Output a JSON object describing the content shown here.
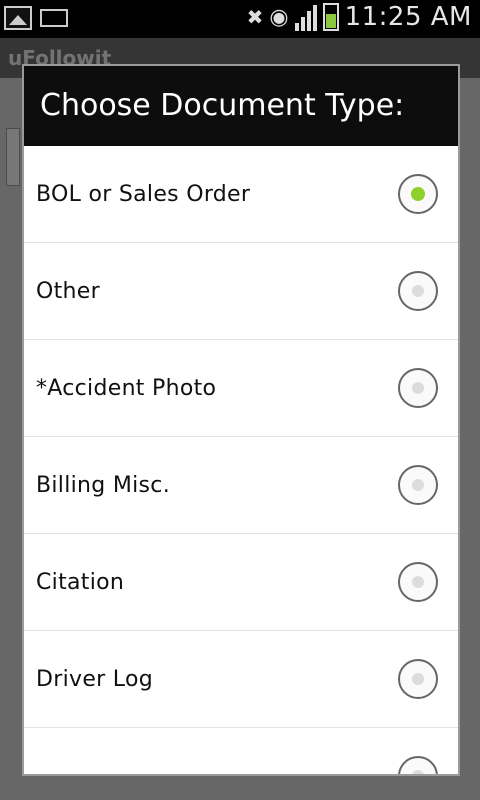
{
  "statusbar": {
    "time": "11:25 AM",
    "left_icons": [
      "image-icon",
      "mail-sync-icon"
    ],
    "right_icons": [
      "mute-icon",
      "wifi-icon",
      "signal-icon",
      "battery-icon"
    ],
    "battery_color": "#8bc63f"
  },
  "app": {
    "title": "uFollowit"
  },
  "dialog": {
    "title": "Choose Document Type:",
    "options": [
      {
        "label": "BOL or Sales Order",
        "selected": true
      },
      {
        "label": "Other",
        "selected": false
      },
      {
        "label": "*Accident Photo",
        "selected": false
      },
      {
        "label": "Billing Misc.",
        "selected": false
      },
      {
        "label": "Citation",
        "selected": false
      },
      {
        "label": "Driver Log",
        "selected": false
      },
      {
        "label": "",
        "selected": false
      }
    ],
    "selected_color": "#8fd12c"
  }
}
